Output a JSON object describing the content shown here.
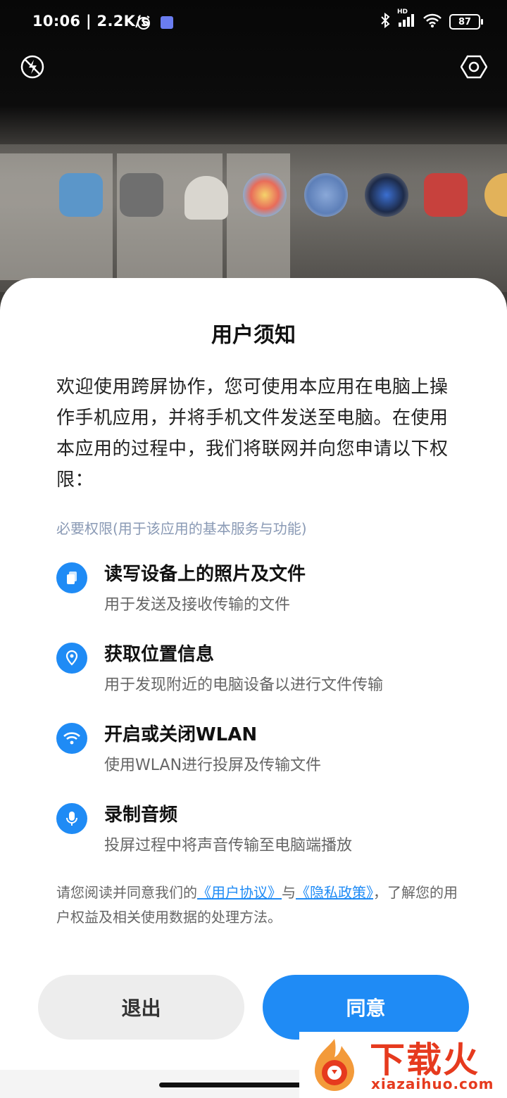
{
  "status_bar": {
    "time": "10:06 | 2.2K/s",
    "battery": "87",
    "network": "HD"
  },
  "camera": {
    "flash_icon": "flash-off-icon",
    "settings_icon": "hexagon-settings-icon"
  },
  "sheet": {
    "title": "用户须知",
    "intro": "欢迎使用跨屏协作，您可使用本应用在电脑上操作手机应用，并将手机文件发送至电脑。在使用本应用的过程中，我们将联网并向您申请以下权限：",
    "section_label": "必要权限(用于该应用的基本服务与功能)",
    "permissions": [
      {
        "icon": "files-icon",
        "title": "读写设备上的照片及文件",
        "desc": "用于发送及接收传输的文件"
      },
      {
        "icon": "location-icon",
        "title": "获取位置信息",
        "desc": "用于发现附近的电脑设备以进行文件传输"
      },
      {
        "icon": "wifi-icon",
        "title": "开启或关闭WLAN",
        "desc": "使用WLAN进行投屏及传输文件"
      },
      {
        "icon": "microphone-icon",
        "title": "录制音频",
        "desc": "投屏过程中将声音传输至电脑端播放"
      }
    ],
    "agree": {
      "prefix": "请您阅读并同意我们的",
      "user_agreement": "《用户协议》",
      "and": "与",
      "privacy_policy": "《隐私政策》",
      "suffix": "，了解您的用户权益及相关使用数据的处理方法。"
    },
    "exit_label": "退出",
    "agree_label": "同意"
  },
  "watermark": {
    "cn": "下载火",
    "en": "xiazaihuo.com"
  },
  "colors": {
    "accent": "#1f8bf5",
    "watermark": "#e63a1e"
  }
}
